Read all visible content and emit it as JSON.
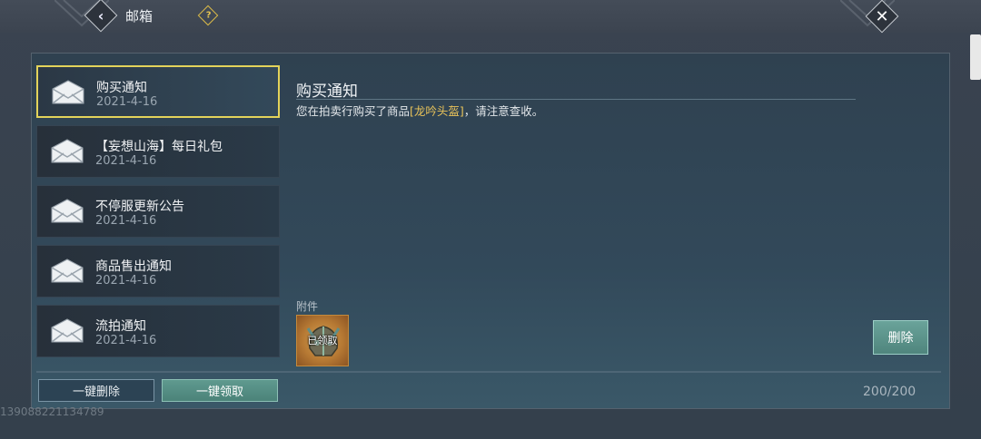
{
  "header": {
    "title": "邮箱",
    "back_icon": "chevron-left-icon",
    "help_icon": "question-diamond-icon",
    "close_icon": "close-icon"
  },
  "mails": [
    {
      "subject": "购买通知",
      "date": "2021-4-16",
      "selected": true
    },
    {
      "subject": "【妄想山海】每日礼包",
      "date": "2021-4-16",
      "selected": false
    },
    {
      "subject": "不停服更新公告",
      "date": "2021-4-16",
      "selected": false
    },
    {
      "subject": "商品售出通知",
      "date": "2021-4-16",
      "selected": false
    },
    {
      "subject": "流拍通知",
      "date": "2021-4-16",
      "selected": false
    }
  ],
  "detail": {
    "title": "购买通知",
    "body_prefix": "您在拍卖行购买了商品",
    "item_name": "[龙吟头盔]",
    "body_suffix": "，请注意查收。",
    "attachment_label": "附件",
    "attachment_status": "已领取",
    "delete_label": "删除"
  },
  "footer": {
    "delete_all_label": "一键删除",
    "claim_all_label": "一键领取",
    "mail_count": "200/200",
    "uid": "139088221134789"
  },
  "colors": {
    "selected_border": "#e3d35a",
    "item_name": "#e8c35a",
    "accent_button": "#5f9a8f"
  }
}
